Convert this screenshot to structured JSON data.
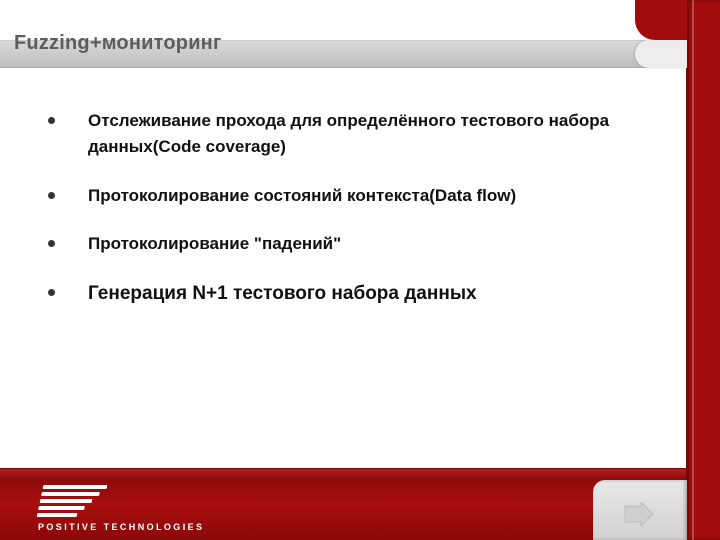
{
  "header": {
    "title": "Fuzzing+мониторинг"
  },
  "bullets": [
    "Отслеживание прохода для определённого тестового набора данных(Code coverage)",
    "Протоколирование состояний контекста(Data flow)",
    "Протоколирование \"падений\"",
    "Генерация N+1 тестового набора данных"
  ],
  "footer": {
    "brand": "POSITIVE TECHNOLOGIES"
  }
}
